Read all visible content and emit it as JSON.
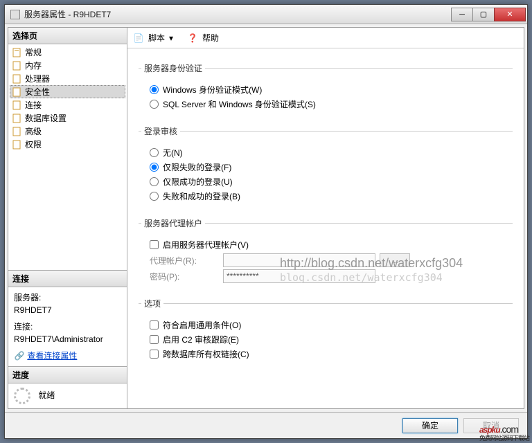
{
  "window": {
    "title": "服务器属性 - R9HDET7"
  },
  "sidebar": {
    "select_page": "选择页",
    "items": [
      {
        "label": "常规"
      },
      {
        "label": "内存"
      },
      {
        "label": "处理器"
      },
      {
        "label": "安全性",
        "selected": true
      },
      {
        "label": "连接"
      },
      {
        "label": "数据库设置"
      },
      {
        "label": "高级"
      },
      {
        "label": "权限"
      }
    ]
  },
  "connection": {
    "header": "连接",
    "server_label": "服务器:",
    "server_value": "R9HDET7",
    "conn_label": "连接:",
    "conn_value": "R9HDET7\\Administrator",
    "view_props": "查看连接属性"
  },
  "progress": {
    "header": "进度",
    "status": "就绪"
  },
  "toolbar": {
    "script": "脚本",
    "help": "帮助"
  },
  "auth": {
    "legend": "服务器身份验证",
    "opt_win": "Windows 身份验证模式(W)",
    "opt_mixed": "SQL Server 和 Windows 身份验证模式(S)"
  },
  "audit": {
    "legend": "登录审核",
    "none": "无(N)",
    "failed": "仅限失败的登录(F)",
    "success": "仅限成功的登录(U)",
    "both": "失败和成功的登录(B)"
  },
  "proxy": {
    "legend": "服务器代理帐户",
    "enable": "启用服务器代理帐户(V)",
    "account_label": "代理帐户(R):",
    "account_value": "",
    "pwd_label": "密码(P):",
    "pwd_value": "**********",
    "browse": "..."
  },
  "options": {
    "legend": "选项",
    "common": "符合启用通用条件(O)",
    "c2": "启用 C2 审核跟踪(E)",
    "crossdb": "跨数据库所有权链接(C)"
  },
  "buttons": {
    "ok": "确定",
    "cancel": "取消"
  },
  "watermark": {
    "url": "http://blog.csdn.net/waterxcfg304",
    "faint": "blog.csdn.net/waterxcfg304"
  },
  "brand": {
    "name": "aspku",
    "suffix": ".com",
    "tag": "免费网站源码下载站"
  }
}
